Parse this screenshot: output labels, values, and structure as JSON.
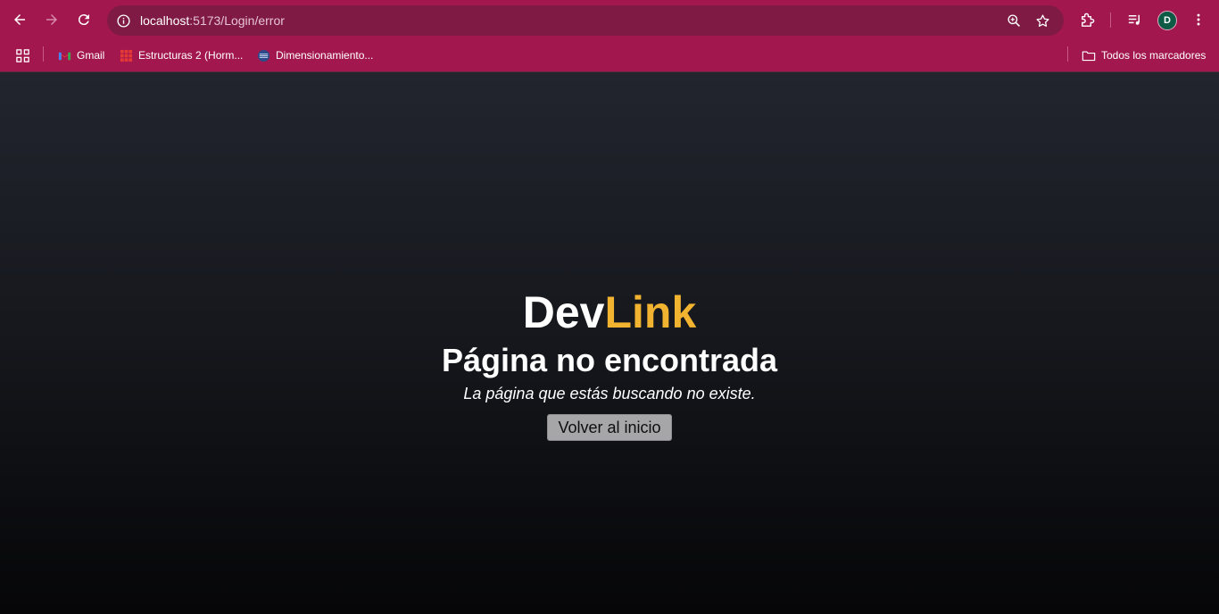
{
  "browser": {
    "url_host": "localhost",
    "url_rest": ":5173/Login/error",
    "avatar_letter": "D",
    "bookmarks": [
      {
        "label": "Gmail",
        "icon": "gmail-icon"
      },
      {
        "label": "Estructuras 2 (Horm...",
        "icon": "grid-favicon-icon"
      },
      {
        "label": "Dimensionamiento...",
        "icon": "site-favicon-icon"
      }
    ],
    "all_bookmarks_label": "Todos los marcadores"
  },
  "page": {
    "brand_dev": "Dev",
    "brand_link": "Link",
    "title": "Página no encontrada",
    "subtitle": "La página que estás buscando no existe.",
    "button_label": "Volver al inicio"
  },
  "colors": {
    "chrome": "#a3174f",
    "omnibox": "#7e1a44",
    "brand_accent": "#f2b330",
    "background_top": "#22252e",
    "background_bottom": "#060608",
    "button_bg": "#a6a6a8"
  }
}
